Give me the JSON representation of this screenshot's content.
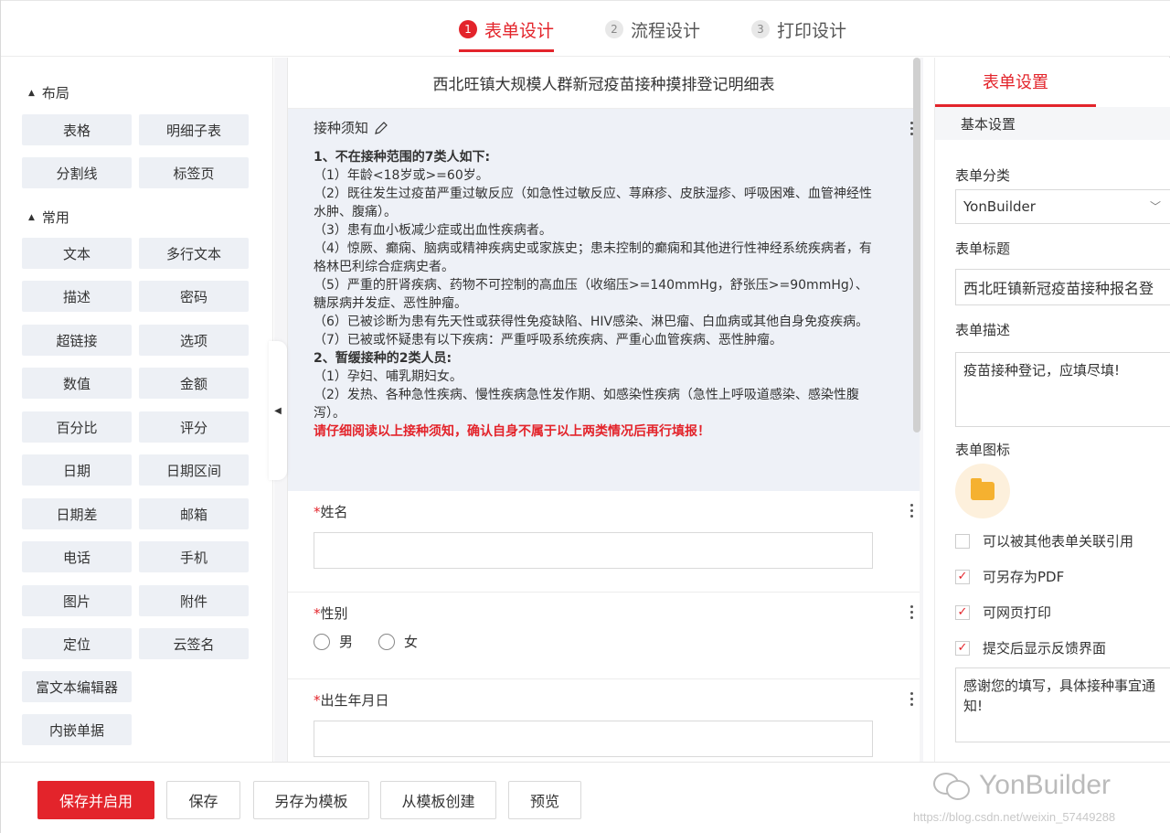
{
  "steps": [
    {
      "num": "1",
      "label": "表单设计",
      "active": true
    },
    {
      "num": "2",
      "label": "流程设计",
      "active": false
    },
    {
      "num": "3",
      "label": "打印设计",
      "active": false
    }
  ],
  "palette": {
    "layout_title": "布局",
    "layout_items": [
      "表格",
      "明细子表",
      "分割线",
      "标签页"
    ],
    "common_title": "常用",
    "common_items": [
      "文本",
      "多行文本",
      "描述",
      "密码",
      "超链接",
      "选项",
      "数值",
      "金额",
      "百分比",
      "评分",
      "日期",
      "日期区间",
      "日期差",
      "邮箱",
      "电话",
      "手机",
      "图片",
      "附件",
      "定位",
      "云签名"
    ],
    "extra_items": [
      "富文本编辑器",
      "内嵌单据"
    ]
  },
  "canvas": {
    "form_title": "西北旺镇大规模人群新冠疫苗接种摸排登记明细表",
    "notice_label": "接种须知",
    "notice_lines": [
      {
        "text": "1、不在接种范围的7类人如下:",
        "style": "b"
      },
      {
        "text": "（1）年龄<18岁或>=60岁。",
        "style": ""
      },
      {
        "text": "（2）既往发生过疫苗严重过敏反应（如急性过敏反应、荨麻疹、皮肤湿疹、呼吸困难、血管神经性水肿、腹痛）。",
        "style": ""
      },
      {
        "text": "（3）患有血小板减少症或出血性疾病者。",
        "style": ""
      },
      {
        "text": "（4）惊厥、癫痫、脑病或精神疾病史或家族史；患未控制的癫痫和其他进行性神经系统疾病者，有格林巴利综合症病史者。",
        "style": ""
      },
      {
        "text": "（5）严重的肝肾疾病、药物不可控制的高血压（收缩压>=140mmHg，舒张压>=90mmHg）、糖尿病并发症、恶性肿瘤。",
        "style": ""
      },
      {
        "text": "（6）已被诊断为患有先天性或获得性免疫缺陷、HIV感染、淋巴瘤、白血病或其他自身免疫疾病。",
        "style": ""
      },
      {
        "text": "（7）已被或怀疑患有以下疾病：严重呼吸系统疾病、严重心血管疾病、恶性肿瘤。",
        "style": ""
      },
      {
        "text": "2、暂缓接种的2类人员:",
        "style": "b"
      },
      {
        "text": "（1）孕妇、哺乳期妇女。",
        "style": ""
      },
      {
        "text": "（2）发热、各种急性疾病、慢性疾病急性发作期、如感染性疾病（急性上呼吸道感染、感染性腹泻）。",
        "style": ""
      },
      {
        "text": "请仔细阅读以上接种须知，确认自身不属于以上两类情况后再行填报！",
        "style": "warn"
      }
    ],
    "fields": {
      "name_label": "姓名",
      "gender_label": "性别",
      "gender_options": [
        "男",
        "女"
      ],
      "birth_label": "出生年月日",
      "required_mark": "*"
    }
  },
  "settings": {
    "tab": "表单设置",
    "section": "基本设置",
    "category_label": "表单分类",
    "category_value": "YonBuilder",
    "title_label": "表单标题",
    "title_value": "西北旺镇新冠疫苗接种报名登",
    "desc_label": "表单描述",
    "desc_value": "疫苗接种登记，应填尽填!",
    "icon_label": "表单图标",
    "checks": [
      {
        "label": "可以被其他表单关联引用",
        "checked": false
      },
      {
        "label": "可另存为PDF",
        "checked": true
      },
      {
        "label": "可网页打印",
        "checked": true
      },
      {
        "label": "提交后显示反馈界面",
        "checked": true
      }
    ],
    "feedback_value": "感谢您的填写，具体接种事宜通知!"
  },
  "toolbar": {
    "save_enable": "保存并启用",
    "save": "保存",
    "save_template": "另存为模板",
    "from_template": "从模板创建",
    "preview": "预览"
  },
  "brand": "YonBuilder",
  "watermark": "https://blog.csdn.net/weixin_57449288",
  "colors": {
    "accent": "#e3242b",
    "palette_bg": "#edf0f5",
    "notice_bg": "#eef1f7"
  }
}
